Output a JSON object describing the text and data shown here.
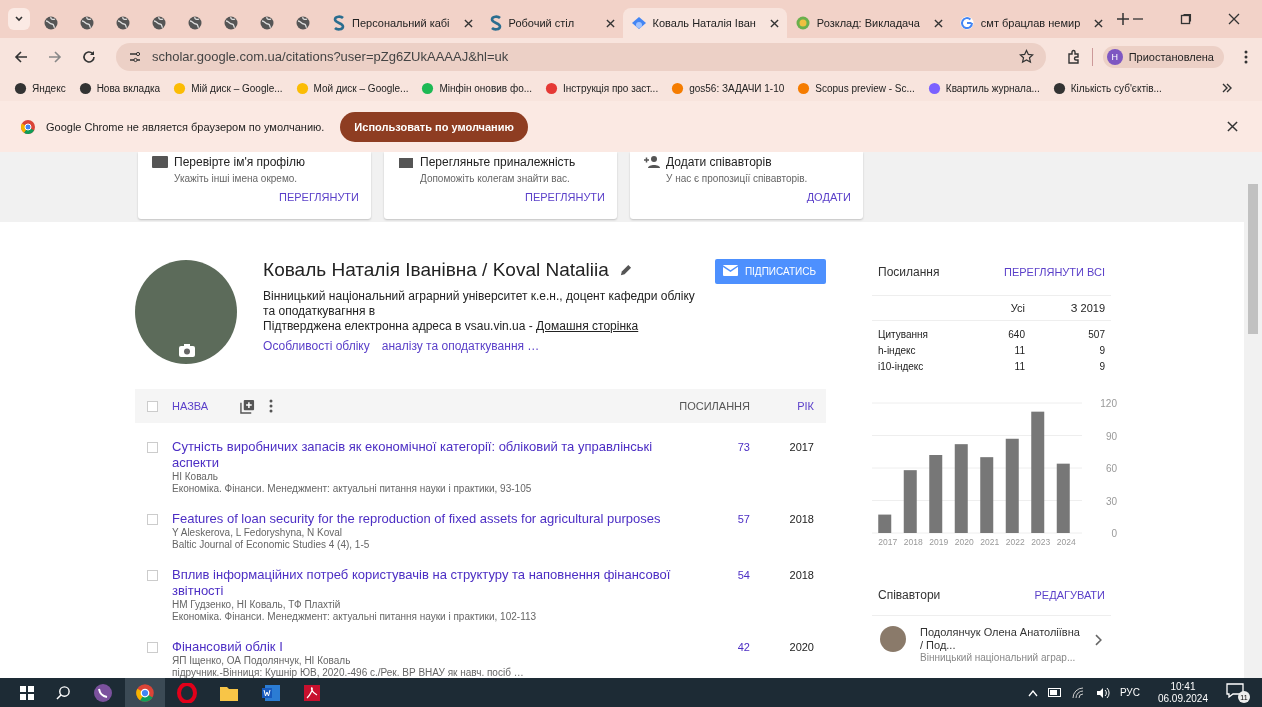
{
  "browser": {
    "tabs": [
      {
        "kind": "icon",
        "selected": false
      },
      {
        "kind": "icon",
        "selected": false
      },
      {
        "kind": "icon",
        "selected": false
      },
      {
        "kind": "icon",
        "selected": false
      },
      {
        "kind": "icon",
        "selected": false
      },
      {
        "kind": "icon",
        "selected": false
      },
      {
        "kind": "icon",
        "selected": false
      },
      {
        "kind": "icon",
        "selected": false
      },
      {
        "kind": "s",
        "title": "Персональний кабі",
        "selected": false
      },
      {
        "kind": "s",
        "title": "Робочий стіл",
        "selected": false
      },
      {
        "kind": "scholar",
        "title": "Коваль Наталія Іван",
        "selected": true
      },
      {
        "kind": "schedule",
        "title": "Розклад: Викладача",
        "selected": false
      },
      {
        "kind": "google",
        "title": "смт брацлав немир",
        "selected": false
      }
    ],
    "url": "scholar.google.com.ua/citations?user=pZg6ZUkAAAAJ&hl=uk",
    "profile": "Приостановлена",
    "profile_initial": "Н",
    "bookmarks": [
      "Яндекс",
      "Нова вкладка",
      "Мій диск – Google...",
      "Мой диск – Google...",
      "Мінфін оновив фо...",
      "Інструкція про заст...",
      "gos56: ЗАДАЧИ 1-10",
      "Scopus preview - Sc...",
      "Квартиль журнала...",
      "Кількість суб'єктів..."
    ],
    "notice": {
      "text": "Google Chrome не является браузером по умолчанию.",
      "button": "Использовать по умолчанию"
    }
  },
  "cards": [
    {
      "title": "Перевірте ім'я профілю",
      "text": "Укажіть інші імена окремо.",
      "action": "ПЕРЕГЛЯНУТИ"
    },
    {
      "title": "Перегляньте приналежність",
      "text": "Допоможіть колегам знайти вас.",
      "action": "ПЕРЕГЛЯНУТИ"
    },
    {
      "title": "Додати співавторів",
      "text": "У нас є пропозиції співавторів.",
      "action": "ДОДАТИ"
    }
  ],
  "profile": {
    "name": "Коваль Наталія Іванівна / Koval Nataliia",
    "affiliation": "Вінницький національний аграрний університет к.е.н., доцент кафедри обліку та оподаткувагння в",
    "email": "Підтверджена електронна адреса в vsau.vin.ua -",
    "homepage": "Домашня сторінка",
    "interests": [
      "Особливості обліку",
      "аналізу та оподаткування …"
    ],
    "follow": "ПІДПИСАТИСЬ"
  },
  "table": {
    "select_all_checked": false,
    "columns": [
      "НАЗВА",
      "ПОСИЛАННЯ",
      "РІК"
    ],
    "rows": [
      {
        "title": "Сутність виробничих запасів як економічної категорії: обліковий та управлінські аспекти",
        "authors": "НІ Коваль",
        "source": "Економіка. Фінанси. Менеджмент: актуальні питання науки і практики, 93-105",
        "cites": "73",
        "year": "2017",
        "checked": false
      },
      {
        "title": "Features of loan security for the reproduction of fixed assets for agricultural purposes",
        "authors": "Y Aleskerova, L Fedoryshyna, N Koval",
        "source": "Baltic Journal of Economic Studies 4 (4), 1-5",
        "cites": "57",
        "year": "2018",
        "checked": false
      },
      {
        "title": "Вплив інформаційних потреб користувачів на структуру та наповнення фінансової звітності",
        "authors": "НМ Гудзенко, НІ Коваль, ТФ Плахтій",
        "source": "Економіка. Фінанси. Менеджмент: актуальні питання науки і практики, 102-113",
        "cites": "54",
        "year": "2018",
        "checked": false
      },
      {
        "title": "Фінансовий облік І",
        "authors": "ЯП Іщенко, ОА Подолянчук, НІ Коваль",
        "source": "підручник.-Вінниця: Кушнір ЮВ, 2020.-496 с./Рек. ВР ВНАУ як навч. посіб …",
        "cites": "42",
        "year": "2020",
        "checked": false
      }
    ]
  },
  "citations": {
    "title": "Посилання",
    "link": "ПЕРЕГЛЯНУТИ ВСІ",
    "headers": [
      "Усі",
      "З 2019"
    ],
    "rows": [
      {
        "label": "Цитування",
        "all": "640",
        "since": "507"
      },
      {
        "label": "h-індекс",
        "all": "11",
        "since": "9"
      },
      {
        "label": "i10-індекс",
        "all": "11",
        "since": "9"
      }
    ],
    "chart_data": {
      "type": "bar",
      "categories": [
        "2017",
        "2018",
        "2019",
        "2020",
        "2021",
        "2022",
        "2023",
        "2024"
      ],
      "values": [
        17,
        58,
        72,
        82,
        70,
        87,
        112,
        64
      ],
      "ylim": [
        0,
        120
      ],
      "grid": true,
      "yticks": [
        0,
        30,
        60,
        90,
        120
      ]
    }
  },
  "coauthors": {
    "title": "Співавтори",
    "link": "РЕДАГУВАТИ",
    "items": [
      {
        "name": "Подолянчук Олена Анатоліївна / Под...",
        "affiliation": "Вінницький національний аграр..."
      }
    ]
  },
  "taskbar": {
    "language": "РУС",
    "time": "10:41",
    "date": "06.09.2024",
    "notifications": "11"
  }
}
